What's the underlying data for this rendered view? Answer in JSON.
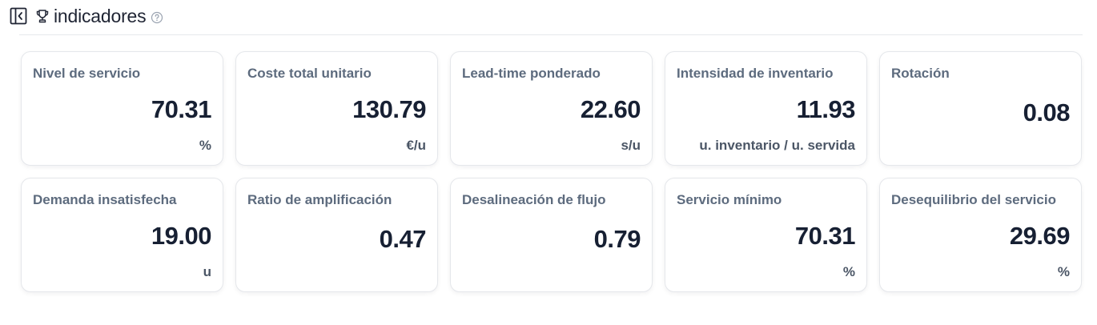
{
  "header": {
    "title": "indicadores",
    "collapse_icon": "sidebar-collapse-icon",
    "title_icon": "trophy-icon",
    "help_icon": "help-circle-icon"
  },
  "colors": {
    "label": "#5d6b7e",
    "value": "#172033",
    "unit": "#4b5666",
    "border": "#e5e7eb"
  },
  "cards": [
    {
      "label": "Nivel de servicio",
      "value": "70.31",
      "unit": "%"
    },
    {
      "label": "Coste total unitario",
      "value": "130.79",
      "unit": "€/u"
    },
    {
      "label": "Lead-time ponderado",
      "value": "22.60",
      "unit": "s/u"
    },
    {
      "label": "Intensidad de inventario",
      "value": "11.93",
      "unit": "u. inventario / u. servida"
    },
    {
      "label": "Rotación",
      "value": "0.08",
      "unit": ""
    },
    {
      "label": "Demanda insatisfecha",
      "value": "19.00",
      "unit": "u"
    },
    {
      "label": "Ratio de amplificación",
      "value": "0.47",
      "unit": ""
    },
    {
      "label": "Desalineación de flujo",
      "value": "0.79",
      "unit": ""
    },
    {
      "label": "Servicio mínimo",
      "value": "70.31",
      "unit": "%"
    },
    {
      "label": "Desequilibrio del servicio",
      "value": "29.69",
      "unit": "%"
    }
  ]
}
